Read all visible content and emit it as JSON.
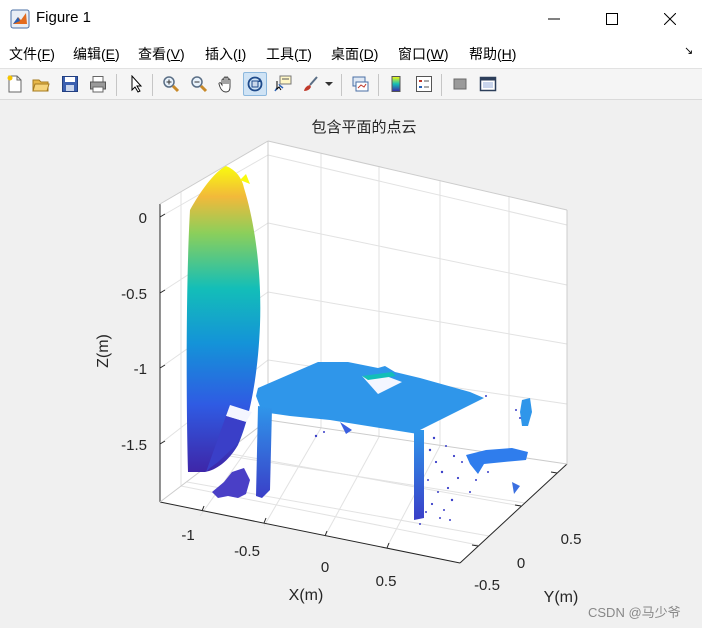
{
  "window": {
    "title": "Figure 1"
  },
  "menu": {
    "items": [
      {
        "label": "文件(",
        "key": "F",
        "end": ")"
      },
      {
        "label": "编辑(",
        "key": "E",
        "end": ")"
      },
      {
        "label": "查看(",
        "key": "V",
        "end": ")"
      },
      {
        "label": "插入(",
        "key": "I",
        "end": ")"
      },
      {
        "label": "工具(",
        "key": "T",
        "end": ")"
      },
      {
        "label": "桌面(",
        "key": "D",
        "end": ")"
      },
      {
        "label": "窗口(",
        "key": "W",
        "end": ")"
      },
      {
        "label": "帮助(",
        "key": "H",
        "end": ")"
      }
    ]
  },
  "toolbar": {
    "buttons": [
      "new-figure-icon",
      "open-icon",
      "save-icon",
      "print-icon",
      "pointer-icon",
      "zoom-in-icon",
      "zoom-out-icon",
      "pan-icon",
      "rotate-3d-icon",
      "data-cursor-icon",
      "brush-icon",
      "link-plot-icon",
      "colorbar-icon",
      "legend-icon",
      "hide-plot-tools-icon",
      "show-plot-tools-icon"
    ],
    "active": "rotate-3d-icon"
  },
  "plot": {
    "title": "包含平面的点云",
    "xlabel": "X(m)",
    "ylabel": "Y(m)",
    "zlabel": "Z(m)",
    "x_ticks": [
      "-1",
      "-0.5",
      "0",
      "0.5"
    ],
    "y_ticks": [
      "-0.5",
      "0",
      "0.5"
    ],
    "z_ticks": [
      "0",
      "-0.5",
      "-1",
      "-1.5"
    ]
  },
  "chart_data": {
    "type": "scatter",
    "title": "包含平面的点云",
    "xlabel": "X(m)",
    "ylabel": "Y(m)",
    "zlabel": "Z(m)",
    "xlim": [
      -1.25,
      0.75
    ],
    "ylim": [
      -0.75,
      0.75
    ],
    "zlim": [
      -1.85,
      0.1
    ],
    "colormap": "parula",
    "grid": true,
    "colors": {
      "low": "#3e26a8",
      "mid": "#13beb8",
      "high": "#f9fb0e",
      "plane": "#2f96ea"
    }
  },
  "watermark": "CSDN @马少爷"
}
